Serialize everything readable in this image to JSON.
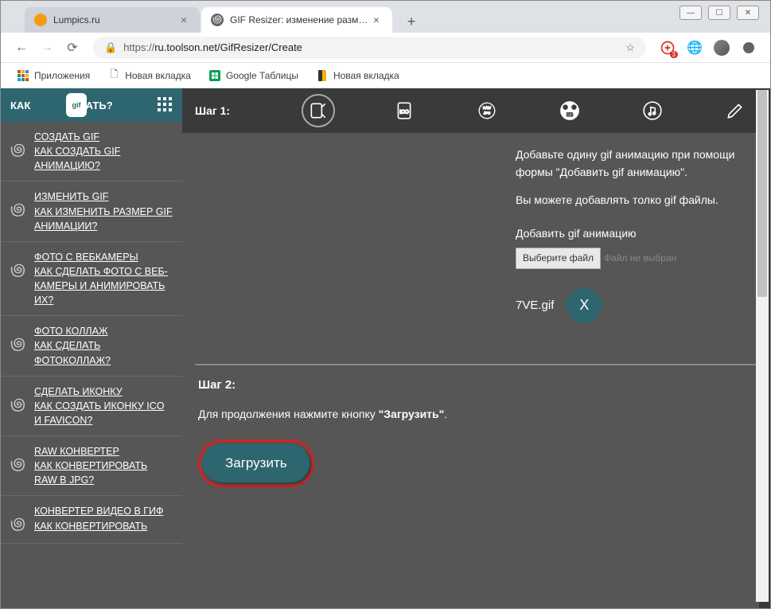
{
  "window": {
    "minimize": "—",
    "maximize": "☐",
    "close": "✕"
  },
  "tabs": [
    {
      "title": "Lumpics.ru",
      "active": false,
      "icon_color": "#f39c12"
    },
    {
      "title": "GIF Resizer: изменение размера",
      "active": true,
      "icon_color": "#666"
    }
  ],
  "new_tab": "+",
  "nav": {
    "back": "←",
    "forward": "→",
    "reload": "⟳"
  },
  "address": {
    "lock": "🔒",
    "url_prefix": "https://",
    "url": "ru.toolson.net/GifResizer/Create",
    "star": "☆"
  },
  "extensions": {
    "badge": "3",
    "globe": "🌐"
  },
  "bookmarks": [
    {
      "icon": "⊞",
      "label": "Приложения",
      "color": "#d92020"
    },
    {
      "icon": "🗋",
      "label": "Новая вкладка",
      "color": "#666"
    },
    {
      "icon": "▦",
      "label": "Google Таблицы",
      "color": "#0f9d58"
    },
    {
      "icon": "◧",
      "label": "Новая вкладка",
      "color": "#f4b400"
    }
  ],
  "sidebar": {
    "header_left": "КАК",
    "header_right": "ЗДАТЬ?",
    "items": [
      {
        "title": "СОЗДАТЬ GIF",
        "sub": "КАК СОЗДАТЬ GIF АНИМАЦИЮ?"
      },
      {
        "title": "ИЗМЕНИТЬ GIF",
        "sub": "КАК ИЗМЕНИТЬ РАЗМЕР GIF АНИМАЦИИ?"
      },
      {
        "title": "ФОТО С ВЕБКАМЕРЫ",
        "sub": "КАК СДЕЛАТЬ ФОТО С ВЕБ-КАМЕРЫ И АНИМИРОВАТЬ ИХ?"
      },
      {
        "title": "ФОТО КОЛЛАЖ",
        "sub": "КАК СДЕЛАТЬ ФОТОКОЛЛАЖ?"
      },
      {
        "title": "СДЕЛАТЬ ИКОНКУ",
        "sub": "КАК СОЗДАТЬ ИКОНКУ ICO И FAVICON?"
      },
      {
        "title": "RAW КОНВЕРТЕР",
        "sub": "КАК КОНВЕРТИРОВАТЬ RAW В JPG?"
      },
      {
        "title": "КОНВЕРТЕР ВИДЕО В ГИФ",
        "sub": "КАК КОНВЕРТИРОВАТЬ"
      }
    ]
  },
  "toolbar": {
    "step1": "Шаг 1:"
  },
  "step1": {
    "line1": "Добавьте одину gif анимацию при помощи формы \"Добавить gif анимацию\".",
    "line2": "Вы можете добавлять толко gif файлы.",
    "upload_label": "Добавить gif анимацию",
    "file_button": "Выберите файл",
    "file_status": "Файл не выбран",
    "file_name": "7VE.gif",
    "remove": "X"
  },
  "step2": {
    "label": "Шаг 2:",
    "desc_pre": "Для продолжения нажмите кнопку ",
    "desc_bold": "\"Загрузить\"",
    "desc_post": ".",
    "button": "Загрузить"
  }
}
